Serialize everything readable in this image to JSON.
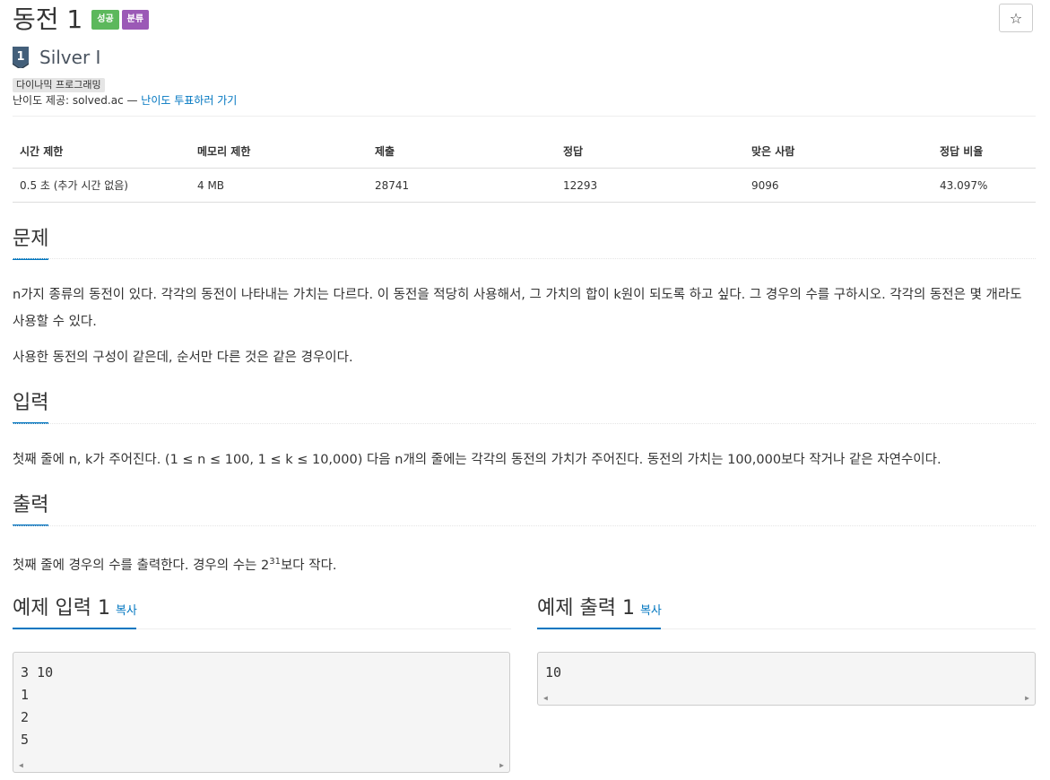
{
  "problem": {
    "title": "동전 1",
    "labels": {
      "success": "성공",
      "classify": "분류"
    },
    "star_glyph": "☆"
  },
  "tier": {
    "name": "Silver I",
    "icon_number": "1"
  },
  "tags": {
    "algo": "다이나믹 프로그래밍"
  },
  "provider": {
    "prefix": "난이도 제공: solved.ac — ",
    "vote_link": "난이도 투표하러 가기"
  },
  "stats": {
    "headers": [
      "시간 제한",
      "메모리 제한",
      "제출",
      "정답",
      "맞은 사람",
      "정답 비율"
    ],
    "values": [
      "0.5 초 (추가 시간 없음)",
      "4 MB",
      "28741",
      "12293",
      "9096",
      "43.097%"
    ]
  },
  "sections": {
    "problem": {
      "title": "문제",
      "p1": "n가지 종류의 동전이 있다. 각각의 동전이 나타내는 가치는 다르다. 이 동전을 적당히 사용해서, 그 가치의 합이 k원이 되도록 하고 싶다. 그 경우의 수를 구하시오. 각각의 동전은 몇 개라도 사용할 수 있다.",
      "p2": "사용한 동전의 구성이 같은데, 순서만 다른 것은 같은 경우이다."
    },
    "input": {
      "title": "입력",
      "p1": "첫째 줄에 n, k가 주어진다. (1 ≤ n ≤ 100, 1 ≤ k ≤ 10,000) 다음 n개의 줄에는 각각의 동전의 가치가 주어진다. 동전의 가치는 100,000보다 작거나 같은 자연수이다."
    },
    "output": {
      "title": "출력",
      "p1_before": "첫째 줄에 경우의 수를 출력한다. 경우의 수는 2",
      "p1_sup": "31",
      "p1_after": "보다 작다."
    }
  },
  "samples": {
    "input": {
      "title": "예제 입력 1",
      "copy": "복사",
      "lines": [
        "3 10",
        "1",
        "2",
        "5"
      ]
    },
    "output": {
      "title": "예제 출력 1",
      "copy": "복사",
      "lines": [
        "10"
      ]
    }
  },
  "colors": {
    "link": "#0076c0",
    "success": "#5cb85c",
    "purple": "#9b59b6",
    "tier": "#435f7a"
  }
}
